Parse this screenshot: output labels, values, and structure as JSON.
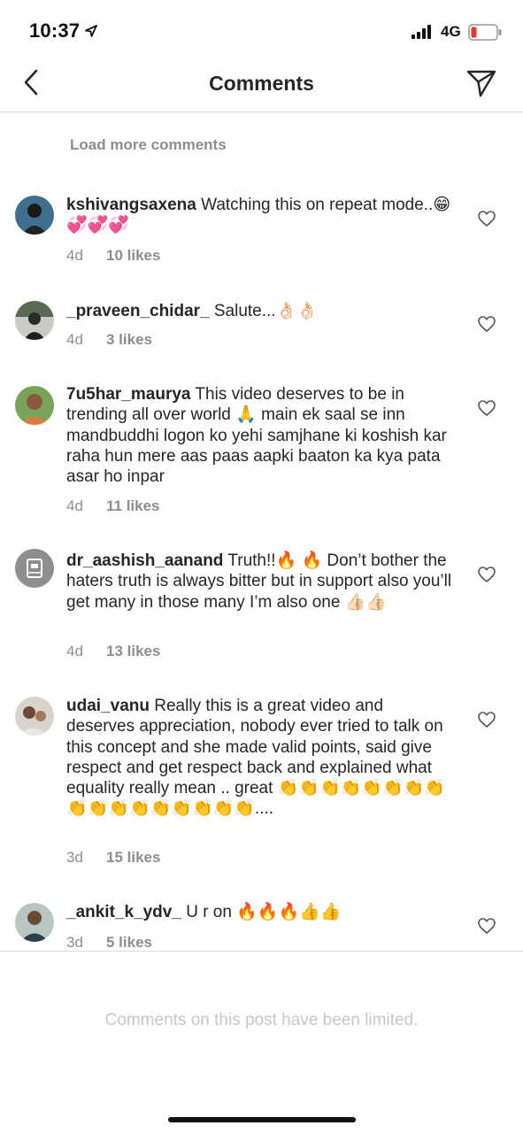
{
  "status_bar": {
    "time": "10:37",
    "network": "4G",
    "battery_color": "#e33b2e"
  },
  "header": {
    "title": "Comments",
    "back_icon": "chevron-left-icon",
    "send_icon": "paper-plane-icon"
  },
  "load_more": "Load more comments",
  "comments": [
    {
      "username": "kshivangsaxena",
      "text": "Watching this on repeat mode..😁💞💞💞",
      "age": "4d",
      "likes": "10 likes"
    },
    {
      "username": "_praveen_chidar_",
      "text": "Salute...👌🏻👌🏻",
      "age": "4d",
      "likes": "3 likes"
    },
    {
      "username": "7u5har_maurya",
      "text": "This video deserves to be in trending all over world 🙏 main ek saal se inn mandbuddhi logon ko yehi samjhane ki koshish kar raha hun mere aas paas aapki baaton ka kya pata asar ho inpar",
      "age": "4d",
      "likes": "11 likes"
    },
    {
      "username": "dr_aashish_aanand",
      "text": "Truth!!🔥 🔥 Don’t bother the haters truth is always bitter but in support also you’ll get many in those many I’m also one 👍🏻👍🏻",
      "age": "4d",
      "likes": "13 likes"
    },
    {
      "username": "udai_vanu",
      "text": "Really this is a great video and deserves appreciation,  nobody ever tried to talk on this concept and she made valid points, said give respect and get respect back and explained what equality really mean .. great 👏👏👏👏👏👏👏👏👏👏👏👏👏👏👏👏👏....",
      "age": "3d",
      "likes": "15 likes"
    },
    {
      "username": "_ankit_k_ydv_",
      "text": "U r on 🔥🔥🔥👍👍",
      "age": "3d",
      "likes": "5 likes"
    }
  ],
  "limited_note": "Comments on this post have been limited."
}
